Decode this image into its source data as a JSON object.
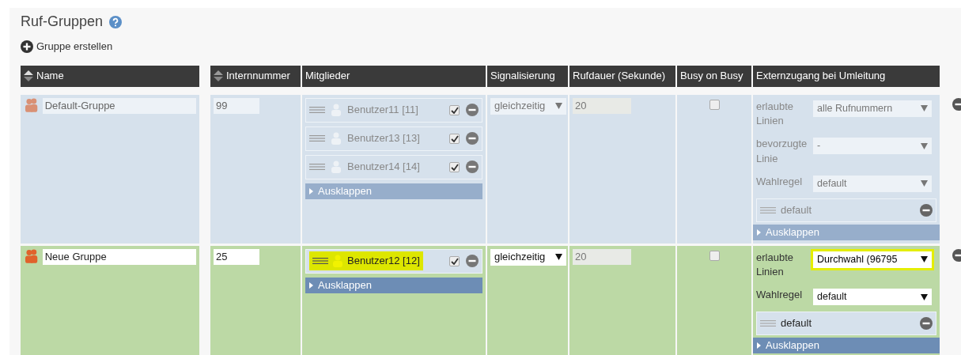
{
  "title": "Ruf-Gruppen",
  "create_link": "Gruppe erstellen",
  "columns": [
    {
      "label": "Name",
      "sortable": true
    },
    {
      "label": "Internnummer",
      "sortable": true
    },
    {
      "label": "Mitglieder",
      "sortable": false
    },
    {
      "label": "Signalisierung",
      "sortable": false
    },
    {
      "label": "Rufdauer (Sekunde)",
      "sortable": false
    },
    {
      "label": "Busy on Busy",
      "sortable": false
    },
    {
      "label": "Externzugang bei Umleitung",
      "sortable": false
    }
  ],
  "groups": [
    {
      "active": false,
      "name": "Default-Gruppe",
      "number": "99",
      "members": [
        {
          "name": "Benutzer11 [11]",
          "checked": true,
          "highlighted": false
        },
        {
          "name": "Benutzer13 [13]",
          "checked": true,
          "highlighted": false
        },
        {
          "name": "Benutzer14 [14]",
          "checked": true,
          "highlighted": false
        }
      ],
      "members_expand": "Ausklappen",
      "signaling": "gleichzeitig",
      "duration": "20",
      "busy_on_busy": false,
      "external": {
        "fields": [
          {
            "label": "erlaubte Linien",
            "value": "alle Rufnummern",
            "highlighted": false
          },
          {
            "label": "bevorzugte Linie",
            "value": "-",
            "highlighted": false
          },
          {
            "label": "Wahlregel",
            "value": "default",
            "highlighted": false
          }
        ],
        "rules": [
          "default"
        ],
        "expand": "Ausklappen"
      }
    },
    {
      "active": true,
      "name": "Neue Gruppe",
      "number": "25",
      "members": [
        {
          "name": "Benutzer12 [12]",
          "checked": true,
          "highlighted": true
        }
      ],
      "members_expand": "Ausklappen",
      "signaling": "gleichzeitig",
      "duration": "20",
      "busy_on_busy": false,
      "external": {
        "fields": [
          {
            "label": "erlaubte Linien",
            "value": "Durchwahl (96795",
            "highlighted": true
          },
          {
            "label": "Wahlregel",
            "value": "default",
            "highlighted": false
          }
        ],
        "rules": [
          "default"
        ],
        "expand": "Ausklappen"
      }
    }
  ]
}
